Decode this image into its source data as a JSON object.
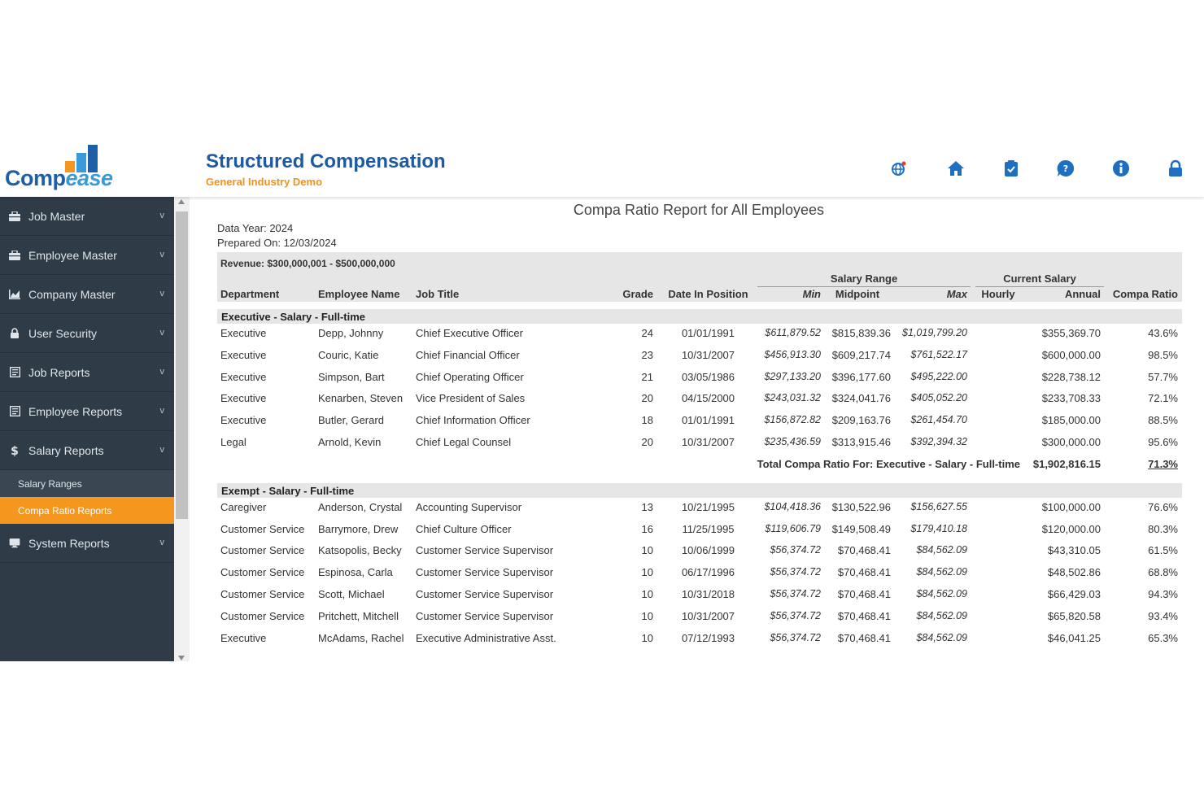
{
  "app": {
    "logo_part1": "Comp",
    "logo_part2": "ease",
    "title": "Structured Compensation",
    "subtitle": "General Industry Demo"
  },
  "colors": {
    "brand_blue": "#1e5aa0",
    "accent_orange": "#f5961e",
    "sidebar_bg": "#2f3b47"
  },
  "header_icons": [
    "globe-icon",
    "home-icon",
    "clipboard-check-icon",
    "help-icon",
    "info-icon",
    "lock-icon"
  ],
  "sidebar": {
    "items": [
      {
        "label": "Job Master",
        "icon": "briefcase-icon"
      },
      {
        "label": "Employee Master",
        "icon": "briefcase-icon"
      },
      {
        "label": "Company Master",
        "icon": "chart-icon"
      },
      {
        "label": "User Security",
        "icon": "lock-icon"
      },
      {
        "label": "Job Reports",
        "icon": "report-icon"
      },
      {
        "label": "Employee Reports",
        "icon": "report-icon"
      },
      {
        "label": "Salary Reports",
        "icon": "dollar-icon"
      }
    ],
    "sub_items": [
      {
        "label": "Salary Ranges",
        "active": false
      },
      {
        "label": "Compa Ratio Reports",
        "active": true
      }
    ],
    "after_items": [
      {
        "label": "System Reports",
        "icon": "monitor-icon"
      }
    ]
  },
  "report": {
    "title": "Compa Ratio Report for All Employees",
    "data_year": "Data Year: 2024",
    "prepared_on": "Prepared On: 12/03/2024",
    "revenue": "Revenue: $300,000,001 - $500,000,000",
    "group_headers": {
      "salary_range": "Salary Range",
      "current_salary": "Current Salary"
    },
    "columns": {
      "department": "Department",
      "employee_name": "Employee Name",
      "job_title": "Job Title",
      "grade": "Grade",
      "date_in_position": "Date In Position",
      "min": "Min",
      "midpoint": "Midpoint",
      "max": "Max",
      "hourly": "Hourly",
      "annual": "Annual",
      "compa_ratio": "Compa Ratio"
    },
    "groups": [
      {
        "title": "Executive - Salary - Full-time",
        "rows": [
          [
            "Executive",
            "Depp, Johnny",
            "Chief Executive Officer",
            "24",
            "01/01/1991",
            "$611,879.52",
            "$815,839.36",
            "$1,019,799.20",
            "",
            "$355,369.70",
            "43.6%"
          ],
          [
            "Executive",
            "Couric, Katie",
            "Chief Financial Officer",
            "23",
            "10/31/2007",
            "$456,913.30",
            "$609,217.74",
            "$761,522.17",
            "",
            "$600,000.00",
            "98.5%"
          ],
          [
            "Executive",
            "Simpson, Bart",
            "Chief Operating Officer",
            "21",
            "03/05/1986",
            "$297,133.20",
            "$396,177.60",
            "$495,222.00",
            "",
            "$228,738.12",
            "57.7%"
          ],
          [
            "Executive",
            "Kenarben, Steven",
            "Vice President of Sales",
            "20",
            "04/15/2000",
            "$243,031.32",
            "$324,041.76",
            "$405,052.20",
            "",
            "$233,708.33",
            "72.1%"
          ],
          [
            "Executive",
            "Butler, Gerard",
            "Chief Information Officer",
            "18",
            "01/01/1991",
            "$156,872.82",
            "$209,163.76",
            "$261,454.70",
            "",
            "$185,000.00",
            "88.5%"
          ],
          [
            "Legal",
            "Arnold, Kevin",
            "Chief Legal Counsel",
            "20",
            "10/31/2007",
            "$235,436.59",
            "$313,915.46",
            "$392,394.32",
            "",
            "$300,000.00",
            "95.6%"
          ]
        ],
        "total_label": "Total Compa Ratio For: Executive - Salary - Full-time",
        "total_annual": "$1,902,816.15",
        "total_ratio": "71.3%"
      },
      {
        "title": "Exempt - Salary - Full-time",
        "rows": [
          [
            "Caregiver",
            "Anderson, Crystal",
            "Accounting Supervisor",
            "13",
            "10/21/1995",
            "$104,418.36",
            "$130,522.96",
            "$156,627.55",
            "",
            "$100,000.00",
            "76.6%"
          ],
          [
            "Customer Service",
            "Barrymore, Drew",
            "Chief Culture Officer",
            "16",
            "11/25/1995",
            "$119,606.79",
            "$149,508.49",
            "$179,410.18",
            "",
            "$120,000.00",
            "80.3%"
          ],
          [
            "Customer Service",
            "Katsopolis, Becky",
            "Customer Service Supervisor",
            "10",
            "10/06/1999",
            "$56,374.72",
            "$70,468.41",
            "$84,562.09",
            "",
            "$43,310.05",
            "61.5%"
          ],
          [
            "Customer Service",
            "Espinosa, Carla",
            "Customer Service Supervisor",
            "10",
            "06/17/1996",
            "$56,374.72",
            "$70,468.41",
            "$84,562.09",
            "",
            "$48,502.86",
            "68.8%"
          ],
          [
            "Customer Service",
            "Scott, Michael",
            "Customer Service Supervisor",
            "10",
            "10/31/2018",
            "$56,374.72",
            "$70,468.41",
            "$84,562.09",
            "",
            "$66,429.03",
            "94.3%"
          ],
          [
            "Customer Service",
            "Pritchett, Mitchell",
            "Customer Service Supervisor",
            "10",
            "10/31/2007",
            "$56,374.72",
            "$70,468.41",
            "$84,562.09",
            "",
            "$65,820.58",
            "93.4%"
          ],
          [
            "Executive",
            "McAdams, Rachel",
            "Executive Administrative Asst.",
            "10",
            "07/12/1993",
            "$56,374.72",
            "$70,468.41",
            "$84,562.09",
            "",
            "$46,041.25",
            "65.3%"
          ]
        ]
      }
    ]
  }
}
